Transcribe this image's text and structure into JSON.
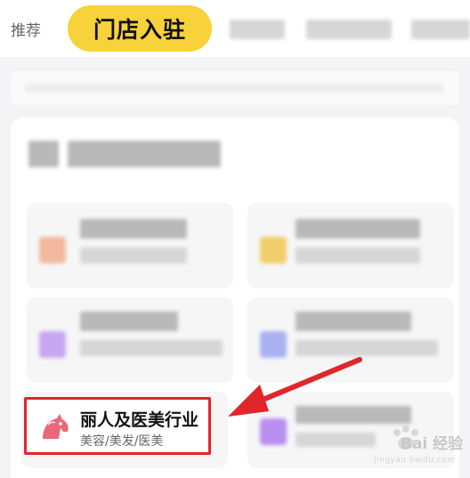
{
  "tabs": {
    "recommend_label": "推荐",
    "active_label": "门店入驻"
  },
  "highlight_card": {
    "title": "丽人及医美行业",
    "subtitle": "美容/美发/医美",
    "icon": "horse-head-icon",
    "icon_color": "#e86a7a",
    "border_color": "#e0262a"
  },
  "watermark": {
    "text": "Bai 经验",
    "sub": "jingyan.baidu.com"
  },
  "colors": {
    "accent_yellow": "#f7d23a",
    "arrow_red": "#e0262a"
  }
}
